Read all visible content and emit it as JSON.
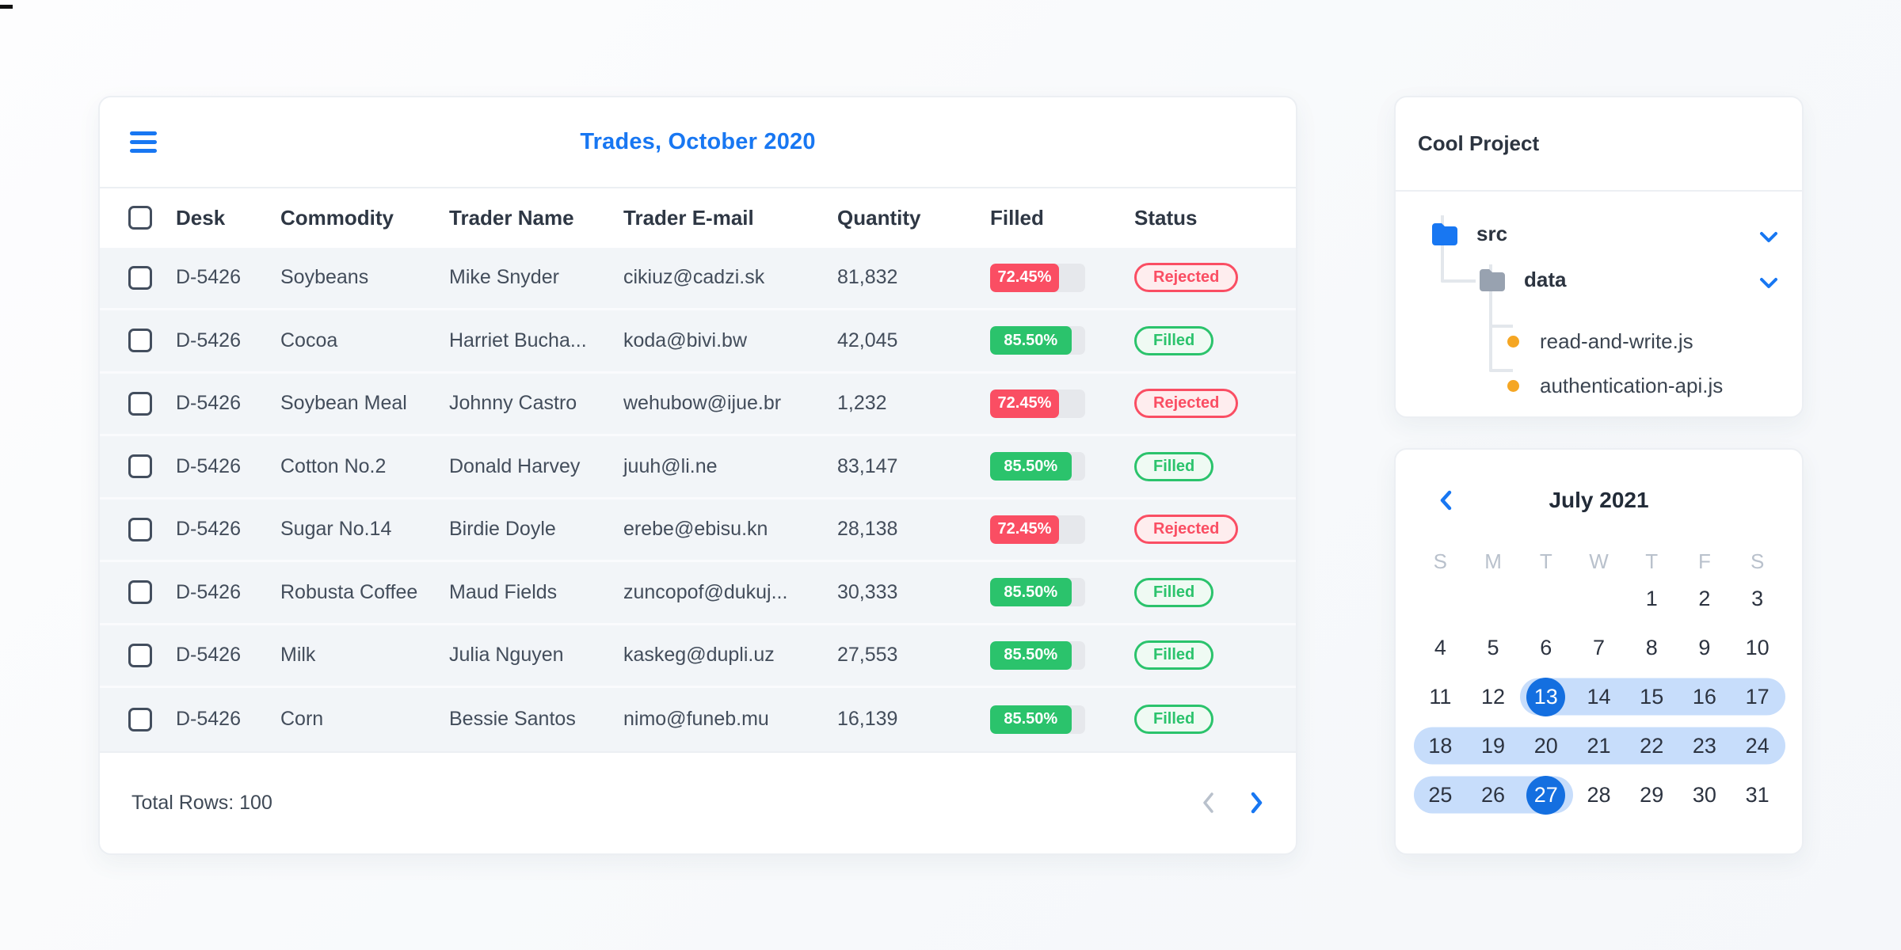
{
  "accent_blue": "#1877f2",
  "table_card": {
    "title": "Trades, October 2020",
    "columns": [
      "Desk",
      "Commodity",
      "Trader Name",
      "Trader E-mail",
      "Quantity",
      "Filled",
      "Status"
    ],
    "rows": [
      {
        "desk": "D-5426",
        "commodity": "Soybeans",
        "trader": "Mike Snyder",
        "email": "cikiuz@cadzi.sk",
        "quantity": "81,832",
        "filled_label": "72.45%",
        "filled_value": 72.45,
        "status": "Rejected"
      },
      {
        "desk": "D-5426",
        "commodity": "Cocoa",
        "trader": "Harriet Bucha...",
        "email": "koda@bivi.bw",
        "quantity": "42,045",
        "filled_label": "85.50%",
        "filled_value": 85.5,
        "status": "Filled"
      },
      {
        "desk": "D-5426",
        "commodity": "Soybean Meal",
        "trader": "Johnny Castro",
        "email": "wehubow@ijue.br",
        "quantity": "1,232",
        "filled_label": "72.45%",
        "filled_value": 72.45,
        "status": "Rejected"
      },
      {
        "desk": "D-5426",
        "commodity": "Cotton No.2",
        "trader": "Donald Harvey",
        "email": "juuh@li.ne",
        "quantity": "83,147",
        "filled_label": "85.50%",
        "filled_value": 85.5,
        "status": "Filled"
      },
      {
        "desk": "D-5426",
        "commodity": "Sugar No.14",
        "trader": "Birdie Doyle",
        "email": "erebe@ebisu.kn",
        "quantity": "28,138",
        "filled_label": "72.45%",
        "filled_value": 72.45,
        "status": "Rejected"
      },
      {
        "desk": "D-5426",
        "commodity": "Robusta Coffee",
        "trader": "Maud Fields",
        "email": "zuncopof@dukuj...",
        "quantity": "30,333",
        "filled_label": "85.50%",
        "filled_value": 85.5,
        "status": "Filled"
      },
      {
        "desk": "D-5426",
        "commodity": "Milk",
        "trader": "Julia Nguyen",
        "email": "kaskeg@dupli.uz",
        "quantity": "27,553",
        "filled_label": "85.50%",
        "filled_value": 85.5,
        "status": "Filled"
      },
      {
        "desk": "D-5426",
        "commodity": "Corn",
        "trader": "Bessie Santos",
        "email": "nimo@funeb.mu",
        "quantity": "16,139",
        "filled_label": "85.50%",
        "filled_value": 85.5,
        "status": "Filled"
      }
    ],
    "status_colors": {
      "Rejected": "#fa4e63",
      "Filled": "#2bc36c"
    },
    "footer": {
      "total_label": "Total Rows: 100"
    }
  },
  "file_tree_card": {
    "title": "Cool Project",
    "folders": [
      {
        "name": "src",
        "icon_color": "#1877f2",
        "expanded": true
      },
      {
        "name": "data",
        "icon_color": "#98a2b0",
        "expanded": true
      }
    ],
    "files": [
      {
        "name": "read-and-write.js"
      },
      {
        "name": "authentication-api.js"
      }
    ],
    "file_dot_color": "#f5a623"
  },
  "calendar_card": {
    "title": "July 2021",
    "day_headers": [
      "S",
      "M",
      "T",
      "W",
      "T",
      "F",
      "S"
    ],
    "weeks": [
      [
        null,
        null,
        null,
        null,
        1,
        2,
        3
      ],
      [
        4,
        5,
        6,
        7,
        8,
        9,
        10
      ],
      [
        11,
        12,
        13,
        14,
        15,
        16,
        17
      ],
      [
        18,
        19,
        20,
        21,
        22,
        23,
        24
      ],
      [
        25,
        26,
        27,
        28,
        29,
        30,
        31
      ]
    ],
    "range_start": 13,
    "range_end": 27,
    "range_color": "#c7ddfb",
    "selected_color": "#146fe0"
  }
}
